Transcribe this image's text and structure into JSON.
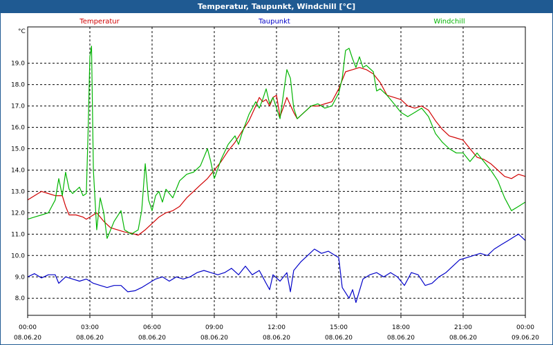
{
  "window": {
    "title": "Temperatur, Taupunkt, Windchill [°C]"
  },
  "colors": {
    "title_bar": "#1f5a92",
    "temperatur": "#d00000",
    "taupunkt": "#0000c8",
    "windchill": "#00b400",
    "grid": "#000000"
  },
  "chart_data": {
    "type": "line",
    "title": "Temperatur, Taupunkt, Windchill [°C]",
    "ylabel": "°C",
    "ylim": [
      7.2,
      20.7
    ],
    "xlim": [
      0,
      24
    ],
    "grid": true,
    "legend": "top",
    "x_ticks": [
      {
        "x": 0,
        "time": "00:00",
        "date": "08.06.20"
      },
      {
        "x": 3,
        "time": "03:00",
        "date": "08.06.20"
      },
      {
        "x": 6,
        "time": "06:00",
        "date": "08.06.20"
      },
      {
        "x": 9,
        "time": "09:00",
        "date": "08.06.20"
      },
      {
        "x": 12,
        "time": "12:00",
        "date": "08.06.20"
      },
      {
        "x": 15,
        "time": "15:00",
        "date": "08.06.20"
      },
      {
        "x": 18,
        "time": "18:00",
        "date": "08.06.20"
      },
      {
        "x": 21,
        "time": "21:00",
        "date": "08.06.20"
      },
      {
        "x": 24,
        "time": "00:00",
        "date": "09.06.20"
      }
    ],
    "y_ticks": [
      "8.0",
      "9.0",
      "10.0",
      "11.0",
      "12.0",
      "13.0",
      "14.0",
      "15.0",
      "16.0",
      "17.0",
      "18.0",
      "19.0"
    ],
    "series": [
      {
        "name": "Temperatur",
        "color": "#d00000",
        "points": [
          [
            0,
            12.6
          ],
          [
            0.33,
            12.8
          ],
          [
            0.67,
            13.0
          ],
          [
            1.0,
            12.9
          ],
          [
            1.33,
            12.8
          ],
          [
            1.67,
            12.8
          ],
          [
            1.83,
            12.3
          ],
          [
            2.0,
            11.9
          ],
          [
            2.33,
            11.9
          ],
          [
            2.67,
            11.8
          ],
          [
            2.83,
            11.7
          ],
          [
            3.0,
            11.8
          ],
          [
            3.17,
            11.9
          ],
          [
            3.33,
            12.0
          ],
          [
            3.67,
            11.6
          ],
          [
            4.0,
            11.3
          ],
          [
            4.33,
            11.2
          ],
          [
            4.67,
            11.1
          ],
          [
            5.0,
            11.05
          ],
          [
            5.33,
            10.95
          ],
          [
            5.67,
            11.2
          ],
          [
            6.0,
            11.5
          ],
          [
            6.33,
            11.8
          ],
          [
            6.67,
            12.0
          ],
          [
            7.0,
            12.1
          ],
          [
            7.33,
            12.3
          ],
          [
            7.67,
            12.7
          ],
          [
            8.0,
            13.0
          ],
          [
            8.33,
            13.3
          ],
          [
            8.67,
            13.6
          ],
          [
            9.0,
            14.0
          ],
          [
            9.33,
            14.4
          ],
          [
            9.67,
            14.9
          ],
          [
            10.0,
            15.3
          ],
          [
            10.33,
            15.8
          ],
          [
            10.67,
            16.3
          ],
          [
            11.0,
            17.0
          ],
          [
            11.17,
            17.4
          ],
          [
            11.33,
            17.2
          ],
          [
            11.5,
            17.3
          ],
          [
            11.67,
            17.0
          ],
          [
            11.83,
            17.4
          ],
          [
            12.0,
            17.5
          ],
          [
            12.17,
            16.5
          ],
          [
            12.5,
            17.4
          ],
          [
            12.83,
            16.7
          ],
          [
            13.0,
            16.4
          ],
          [
            13.33,
            16.7
          ],
          [
            13.67,
            17.0
          ],
          [
            14.0,
            17.0
          ],
          [
            14.33,
            17.1
          ],
          [
            14.67,
            17.2
          ],
          [
            15.0,
            17.8
          ],
          [
            15.33,
            18.6
          ],
          [
            15.67,
            18.7
          ],
          [
            16.0,
            18.8
          ],
          [
            16.33,
            18.7
          ],
          [
            16.67,
            18.5
          ],
          [
            17.0,
            18.1
          ],
          [
            17.33,
            17.5
          ],
          [
            17.67,
            17.4
          ],
          [
            18.0,
            17.3
          ],
          [
            18.33,
            17.0
          ],
          [
            18.67,
            16.9
          ],
          [
            19.0,
            17.0
          ],
          [
            19.33,
            16.8
          ],
          [
            19.67,
            16.3
          ],
          [
            20.0,
            15.9
          ],
          [
            20.33,
            15.6
          ],
          [
            20.67,
            15.5
          ],
          [
            21.0,
            15.4
          ],
          [
            21.33,
            15.0
          ],
          [
            21.67,
            14.6
          ],
          [
            22.0,
            14.5
          ],
          [
            22.33,
            14.3
          ],
          [
            22.67,
            14.0
          ],
          [
            23.0,
            13.7
          ],
          [
            23.33,
            13.6
          ],
          [
            23.67,
            13.8
          ],
          [
            24.0,
            13.7
          ]
        ]
      },
      {
        "name": "Taupunkt",
        "color": "#0000c8",
        "points": [
          [
            0,
            9.0
          ],
          [
            0.33,
            9.15
          ],
          [
            0.67,
            8.95
          ],
          [
            1.0,
            9.1
          ],
          [
            1.33,
            9.1
          ],
          [
            1.5,
            8.7
          ],
          [
            1.83,
            9.0
          ],
          [
            2.17,
            8.9
          ],
          [
            2.5,
            8.8
          ],
          [
            2.83,
            8.9
          ],
          [
            3.17,
            8.7
          ],
          [
            3.5,
            8.6
          ],
          [
            3.83,
            8.5
          ],
          [
            4.17,
            8.6
          ],
          [
            4.5,
            8.6
          ],
          [
            4.83,
            8.3
          ],
          [
            5.17,
            8.35
          ],
          [
            5.5,
            8.5
          ],
          [
            5.83,
            8.7
          ],
          [
            6.17,
            8.9
          ],
          [
            6.5,
            9.0
          ],
          [
            6.83,
            8.8
          ],
          [
            7.17,
            9.0
          ],
          [
            7.5,
            8.9
          ],
          [
            7.83,
            9.0
          ],
          [
            8.17,
            9.2
          ],
          [
            8.5,
            9.3
          ],
          [
            8.83,
            9.2
          ],
          [
            9.17,
            9.1
          ],
          [
            9.5,
            9.2
          ],
          [
            9.83,
            9.4
          ],
          [
            10.17,
            9.1
          ],
          [
            10.5,
            9.5
          ],
          [
            10.83,
            9.1
          ],
          [
            11.17,
            9.3
          ],
          [
            11.5,
            8.7
          ],
          [
            11.67,
            8.4
          ],
          [
            11.83,
            9.1
          ],
          [
            12.17,
            8.8
          ],
          [
            12.5,
            9.2
          ],
          [
            12.67,
            8.3
          ],
          [
            12.83,
            9.3
          ],
          [
            13.17,
            9.7
          ],
          [
            13.5,
            10.0
          ],
          [
            13.83,
            10.3
          ],
          [
            14.17,
            10.1
          ],
          [
            14.5,
            10.2
          ],
          [
            14.83,
            10.0
          ],
          [
            15.0,
            9.9
          ],
          [
            15.17,
            8.5
          ],
          [
            15.5,
            8.0
          ],
          [
            15.67,
            8.4
          ],
          [
            15.83,
            7.8
          ],
          [
            16.17,
            8.9
          ],
          [
            16.5,
            9.1
          ],
          [
            16.83,
            9.2
          ],
          [
            17.17,
            9.0
          ],
          [
            17.5,
            9.2
          ],
          [
            17.83,
            9.0
          ],
          [
            18.17,
            8.6
          ],
          [
            18.5,
            9.2
          ],
          [
            18.83,
            9.1
          ],
          [
            19.17,
            8.6
          ],
          [
            19.5,
            8.7
          ],
          [
            19.83,
            9.0
          ],
          [
            20.17,
            9.2
          ],
          [
            20.5,
            9.5
          ],
          [
            20.83,
            9.8
          ],
          [
            21.17,
            9.9
          ],
          [
            21.5,
            10.0
          ],
          [
            21.83,
            10.1
          ],
          [
            22.17,
            10.0
          ],
          [
            22.5,
            10.3
          ],
          [
            22.83,
            10.5
          ],
          [
            23.17,
            10.7
          ],
          [
            23.5,
            10.9
          ],
          [
            23.67,
            11.0
          ],
          [
            24.0,
            10.7
          ]
        ]
      },
      {
        "name": "Windchill",
        "color": "#00b400",
        "points": [
          [
            0,
            11.7
          ],
          [
            0.33,
            11.8
          ],
          [
            0.67,
            11.9
          ],
          [
            1.0,
            12.0
          ],
          [
            1.33,
            12.6
          ],
          [
            1.5,
            13.6
          ],
          [
            1.67,
            12.8
          ],
          [
            1.83,
            13.9
          ],
          [
            2.0,
            13.1
          ],
          [
            2.17,
            12.9
          ],
          [
            2.5,
            13.2
          ],
          [
            2.67,
            12.8
          ],
          [
            2.83,
            12.9
          ],
          [
            2.92,
            16.0
          ],
          [
            3.0,
            19.3
          ],
          [
            3.08,
            19.8
          ],
          [
            3.17,
            14.0
          ],
          [
            3.33,
            11.2
          ],
          [
            3.5,
            12.7
          ],
          [
            3.67,
            12.0
          ],
          [
            3.83,
            10.8
          ],
          [
            4.17,
            11.6
          ],
          [
            4.5,
            12.1
          ],
          [
            4.67,
            11.2
          ],
          [
            5.0,
            11.0
          ],
          [
            5.33,
            11.2
          ],
          [
            5.5,
            12.1
          ],
          [
            5.67,
            14.3
          ],
          [
            5.83,
            12.6
          ],
          [
            6.0,
            12.1
          ],
          [
            6.17,
            12.8
          ],
          [
            6.33,
            13.0
          ],
          [
            6.5,
            12.5
          ],
          [
            6.67,
            13.1
          ],
          [
            7.0,
            12.7
          ],
          [
            7.33,
            13.5
          ],
          [
            7.67,
            13.8
          ],
          [
            8.0,
            13.9
          ],
          [
            8.33,
            14.2
          ],
          [
            8.67,
            15.0
          ],
          [
            8.83,
            14.4
          ],
          [
            9.0,
            13.6
          ],
          [
            9.33,
            14.5
          ],
          [
            9.67,
            15.2
          ],
          [
            10.0,
            15.6
          ],
          [
            10.17,
            15.2
          ],
          [
            10.33,
            15.7
          ],
          [
            10.67,
            16.6
          ],
          [
            11.0,
            17.2
          ],
          [
            11.17,
            16.9
          ],
          [
            11.33,
            17.3
          ],
          [
            11.5,
            17.8
          ],
          [
            11.67,
            17.1
          ],
          [
            11.83,
            17.4
          ],
          [
            12.0,
            16.9
          ],
          [
            12.17,
            16.4
          ],
          [
            12.5,
            18.7
          ],
          [
            12.67,
            18.3
          ],
          [
            12.83,
            16.9
          ],
          [
            13.0,
            16.4
          ],
          [
            13.33,
            16.7
          ],
          [
            13.67,
            17.0
          ],
          [
            14.0,
            17.1
          ],
          [
            14.33,
            16.9
          ],
          [
            14.67,
            17.0
          ],
          [
            15.0,
            17.6
          ],
          [
            15.17,
            18.3
          ],
          [
            15.33,
            19.6
          ],
          [
            15.5,
            19.7
          ],
          [
            15.67,
            19.2
          ],
          [
            15.83,
            18.8
          ],
          [
            16.0,
            19.3
          ],
          [
            16.17,
            18.8
          ],
          [
            16.33,
            18.9
          ],
          [
            16.67,
            18.6
          ],
          [
            16.83,
            17.7
          ],
          [
            17.0,
            17.8
          ],
          [
            17.33,
            17.5
          ],
          [
            17.67,
            17.1
          ],
          [
            18.0,
            16.7
          ],
          [
            18.33,
            16.5
          ],
          [
            18.67,
            16.7
          ],
          [
            19.0,
            16.9
          ],
          [
            19.33,
            16.5
          ],
          [
            19.67,
            15.7
          ],
          [
            20.0,
            15.3
          ],
          [
            20.33,
            15.0
          ],
          [
            20.67,
            14.8
          ],
          [
            21.0,
            14.8
          ],
          [
            21.33,
            14.4
          ],
          [
            21.67,
            14.8
          ],
          [
            22.0,
            14.4
          ],
          [
            22.33,
            14.0
          ],
          [
            22.67,
            13.5
          ],
          [
            23.0,
            12.7
          ],
          [
            23.33,
            12.1
          ],
          [
            23.67,
            12.3
          ],
          [
            24.0,
            12.5
          ]
        ]
      }
    ]
  }
}
